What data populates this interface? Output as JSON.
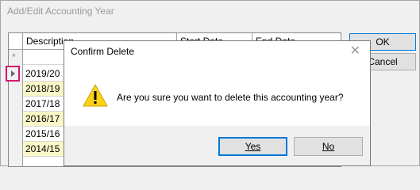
{
  "window": {
    "title": "Add/Edit Accounting Year",
    "ok_label": "OK",
    "cancel_label": "Cancel"
  },
  "grid": {
    "columns": [
      "Description",
      "Start Date",
      "End Date"
    ],
    "new_row_marker": "*",
    "rows": [
      "2019/20",
      "2018/19",
      "2017/18",
      "2016/17",
      "2015/16",
      "2014/15"
    ]
  },
  "dialog": {
    "title": "Confirm Delete",
    "message": "Are you sure you want to delete this accounting year?",
    "yes_label": "Yes",
    "no_label": "No",
    "icon": "warning-icon",
    "close_icon": "close-icon"
  },
  "colors": {
    "accent": "#0078d7",
    "highlight_row": "#faf7c8",
    "current_row_marker": "#d1186b",
    "warning": "#fcd116"
  }
}
